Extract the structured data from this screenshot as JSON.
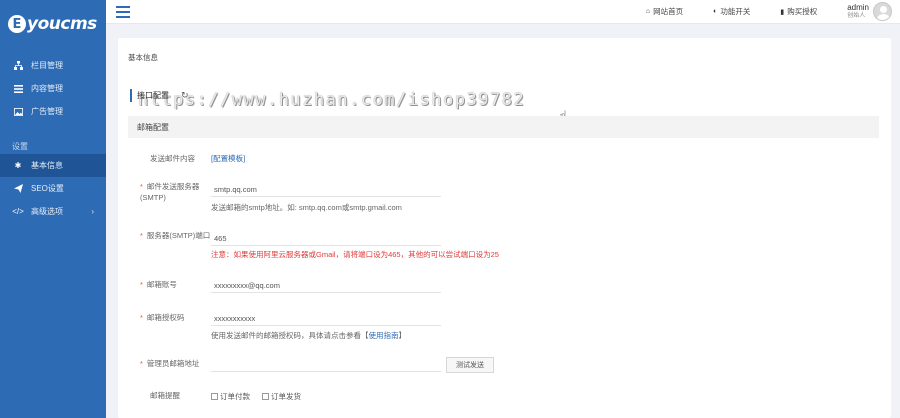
{
  "brand": {
    "logo_mark": "E",
    "logo_text": "youcms"
  },
  "sidebar": {
    "items": [
      {
        "icon": "sitemap-icon",
        "label": "栏目管理"
      },
      {
        "icon": "list-icon",
        "label": "内容管理"
      },
      {
        "icon": "image-icon",
        "label": "广告管理"
      }
    ],
    "group_label": "设置",
    "settings_items": [
      {
        "icon": "gear-icon",
        "label": "基本信息",
        "active": true
      },
      {
        "icon": "send-icon",
        "label": "SEO设置"
      },
      {
        "icon": "code-icon",
        "label": "高级选项",
        "has_submenu": true
      }
    ]
  },
  "topbar": {
    "links": [
      {
        "icon": "home-icon",
        "label": "网站首页"
      },
      {
        "icon": "toggle-icon",
        "label": "功能开关"
      },
      {
        "icon": "bookmark-icon",
        "label": "购买授权"
      }
    ],
    "user": {
      "name": "admin",
      "role": "创始人"
    }
  },
  "main": {
    "tabs": [
      "基本信息",
      "",
      "",
      "",
      "",
      ""
    ],
    "watermark": "https://www.huzhan.com/ishop39782",
    "subtab_label": "接口配置",
    "section_title": "邮箱配置",
    "form": {
      "template_label": "发送邮件内容",
      "template_link": "[配置模板]",
      "smtp_server_label": "邮件发送服务器(SMTP)",
      "smtp_server_value": "smtp.qq.com",
      "smtp_server_hint": "发送邮箱的smtp地址。如: smtp.qq.com或smtp.gmail.com",
      "smtp_port_label": "服务器(SMTP)端口",
      "smtp_port_value": "465",
      "smtp_port_warning": "注意：如果使用阿里云服务器或Gmail，请将端口设为465，其他的可以尝试端口设为25",
      "account_label": "邮箱账号",
      "account_value": "xxxxxxxxx@qq.com",
      "auth_code_label": "邮箱授权码",
      "auth_code_value": "xxxxxxxxxxx",
      "auth_code_hint_prefix": "使用发送邮件的邮箱授权码，具体请点击参看【",
      "auth_code_hint_link": "使用指南",
      "auth_code_hint_suffix": "】",
      "admin_email_label": "管理员邮箱地址",
      "admin_email_value": "",
      "test_button": "测试发送",
      "notify_label": "邮箱提醒",
      "notify_options": [
        "订单付款",
        "订单发货"
      ]
    }
  }
}
